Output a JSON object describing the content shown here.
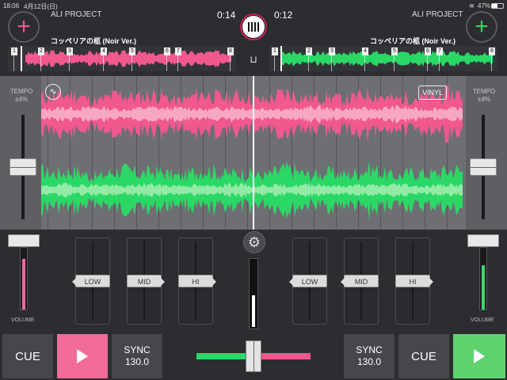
{
  "status": {
    "time": "18:06",
    "date": "4月12日(日)",
    "battery": "47%"
  },
  "colors": {
    "deck_a": "#f0588e",
    "deck_b": "#2bd866",
    "panel": "#2c2d30"
  },
  "deck_a": {
    "artist": "ALI PROJECT",
    "title": "コッペリアの柩 (Noir Ver.)",
    "time": "0:14",
    "add_icon": "plus-icon",
    "cue_points": [
      "1",
      "2",
      "3",
      "4",
      "5",
      "6",
      "7",
      "8"
    ],
    "tempo_label": "TEMPO",
    "tempo_range": "±4%",
    "volume_label": "VOLUME",
    "eq": [
      "LOW",
      "MID",
      "HI"
    ],
    "cue_label": "CUE",
    "sync_label": "SYNC",
    "bpm": "130.0"
  },
  "deck_b": {
    "artist": "ALI PROJECT",
    "title": "コッペリアの柩 (Noir Ver.)",
    "time": "0:12",
    "add_icon": "plus-icon",
    "cue_points": [
      "1",
      "2",
      "3",
      "4",
      "5",
      "6",
      "7",
      "8"
    ],
    "tempo_label": "TEMPO",
    "tempo_range": "±4%",
    "volume_label": "VOLUME",
    "eq": [
      "LOW",
      "MID",
      "HI"
    ],
    "cue_label": "CUE",
    "sync_label": "SYNC",
    "bpm": "130.0",
    "vinyl_label": "VINYL"
  },
  "mixer": {
    "settings_icon": "gear-icon",
    "crossfader_position": 0.5,
    "deck_a_volume": 0.8,
    "deck_b_volume": 0.7,
    "master_level": 0.45
  }
}
